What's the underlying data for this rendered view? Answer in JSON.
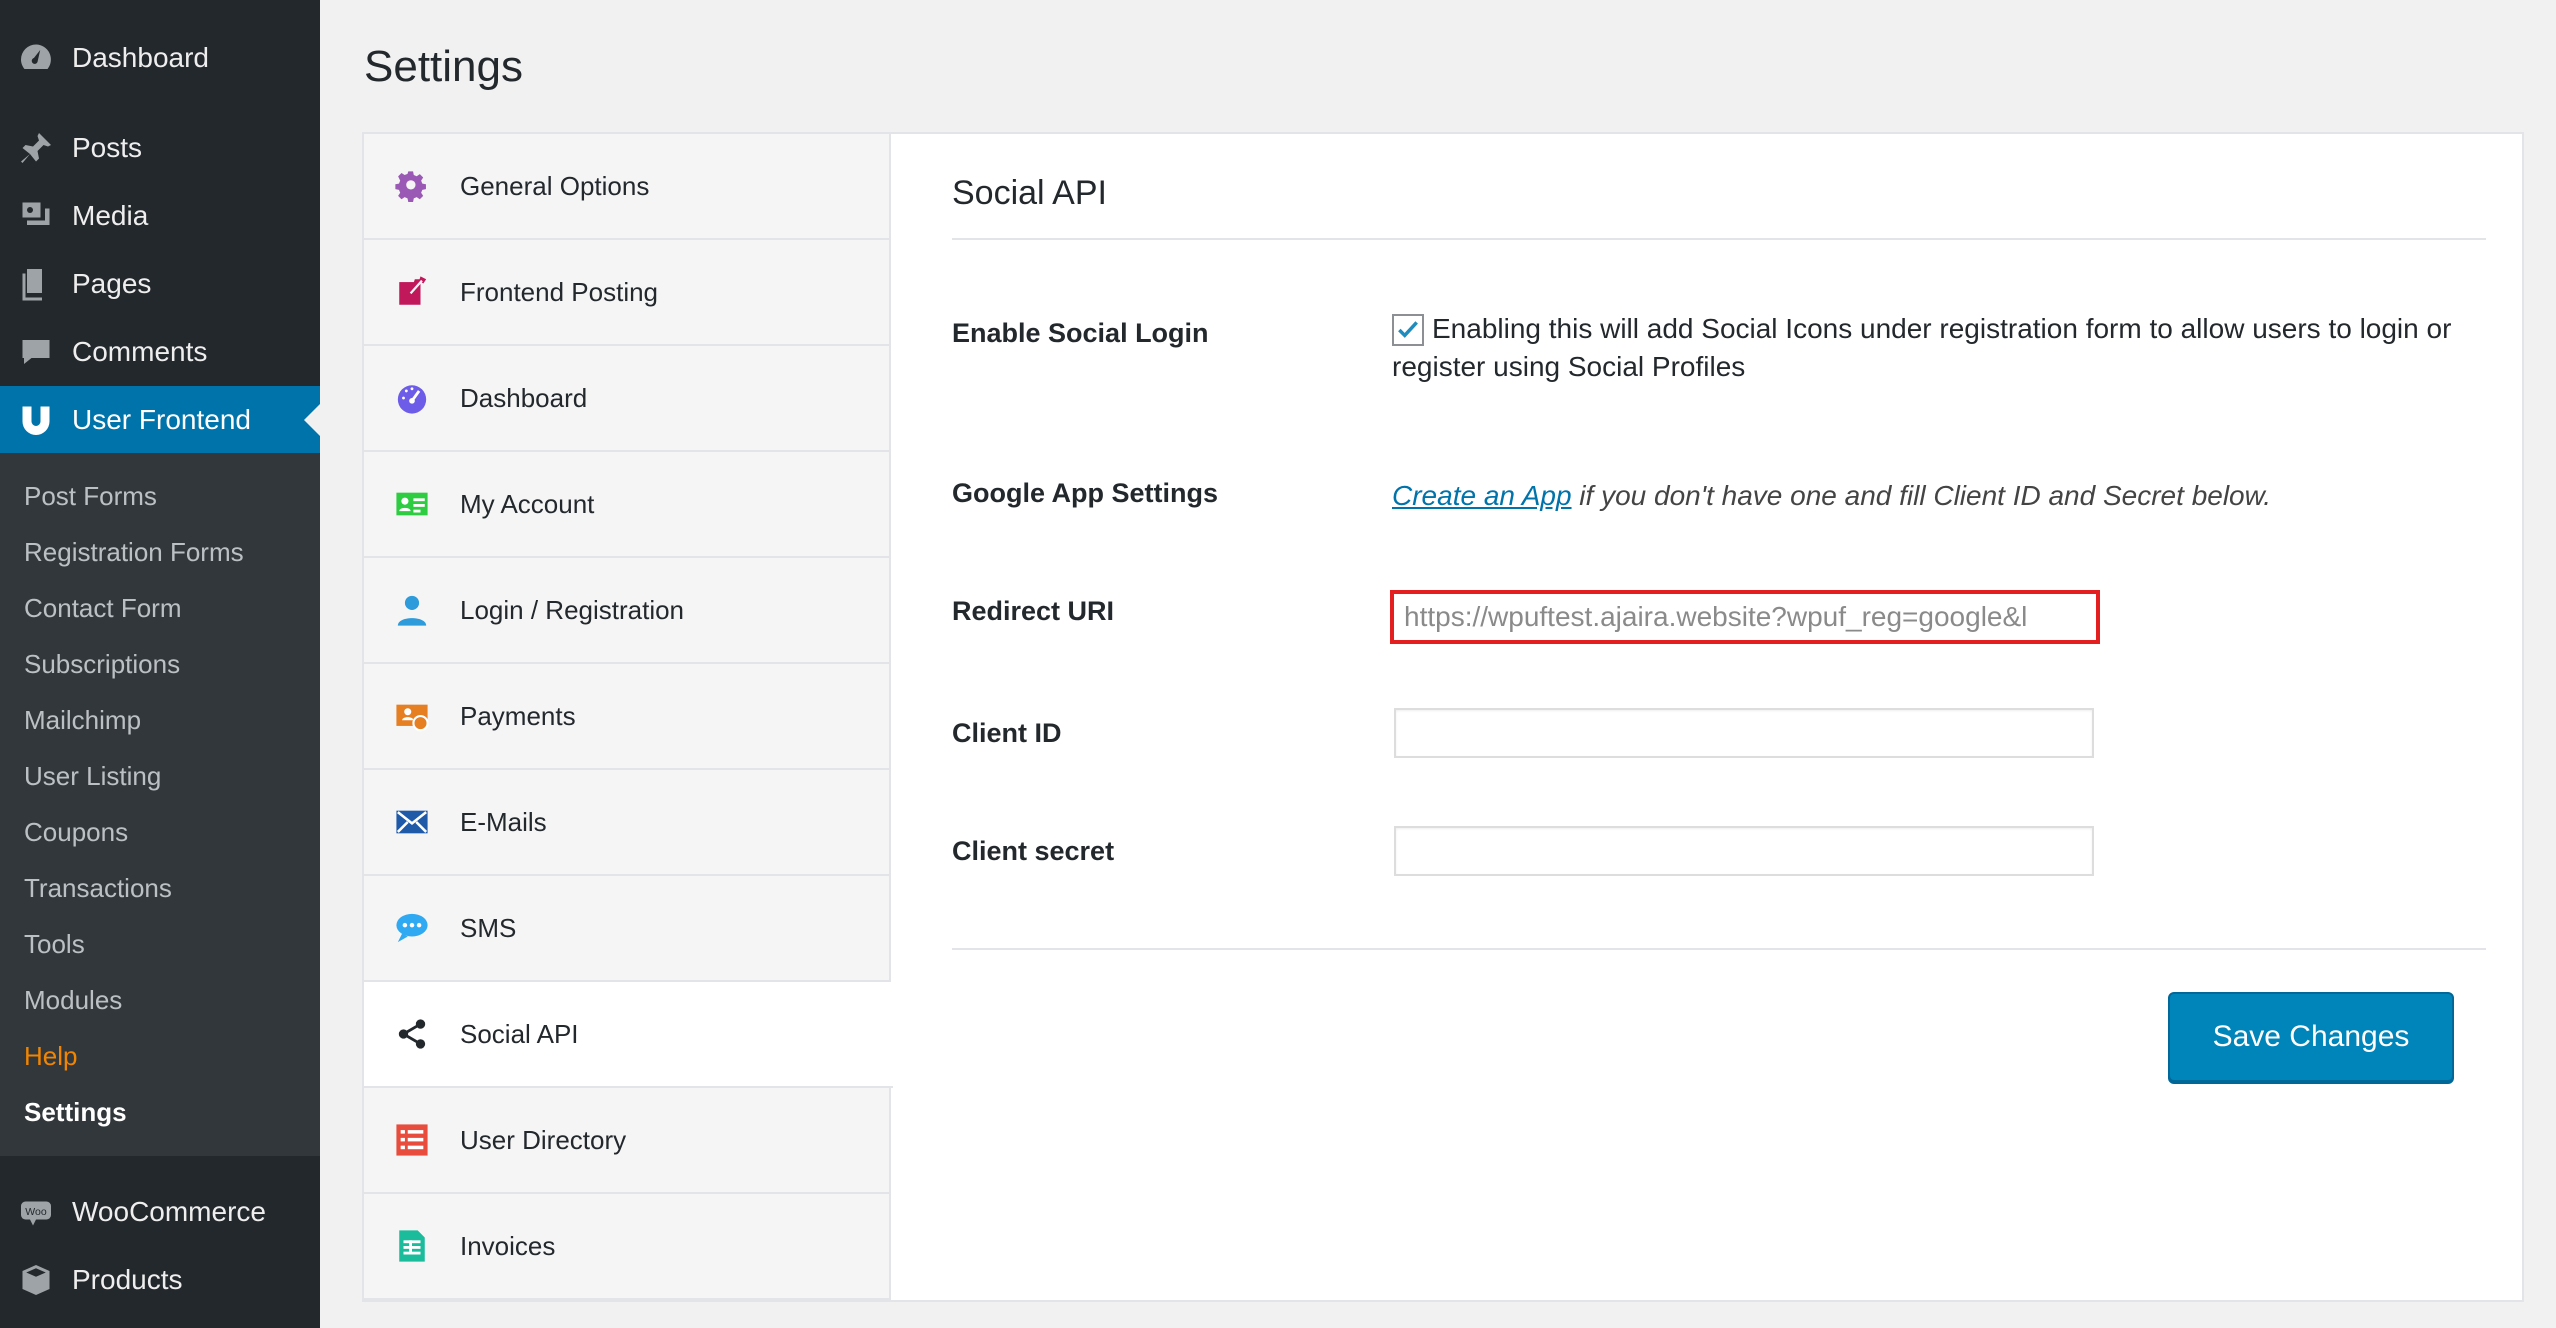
{
  "sidebar": {
    "top_items": [
      {
        "label": "Dashboard",
        "icon": "dashboard-icon"
      },
      {
        "label": "Posts",
        "icon": "pin-icon"
      },
      {
        "label": "Media",
        "icon": "media-icon"
      },
      {
        "label": "Pages",
        "icon": "pages-icon"
      },
      {
        "label": "Comments",
        "icon": "comment-icon"
      },
      {
        "label": "User Frontend",
        "icon": "user-frontend-icon"
      }
    ],
    "submenu": [
      "Post Forms",
      "Registration Forms",
      "Contact Form",
      "Subscriptions",
      "Mailchimp",
      "User Listing",
      "Coupons",
      "Transactions",
      "Tools",
      "Modules",
      "Help",
      "Settings"
    ],
    "bottom_items": [
      {
        "label": "WooCommerce",
        "icon": "woo-icon"
      },
      {
        "label": "Products",
        "icon": "box-icon"
      }
    ]
  },
  "page": {
    "title": "Settings"
  },
  "tabs": [
    {
      "label": "General Options",
      "icon": "gear-icon",
      "color": "#9b59b6"
    },
    {
      "label": "Frontend Posting",
      "icon": "edit-icon",
      "color": "#c0185b"
    },
    {
      "label": "Dashboard",
      "icon": "dashboard-icon",
      "color": "#6c5ce7"
    },
    {
      "label": "My Account",
      "icon": "id-card-icon",
      "color": "#2ecc40"
    },
    {
      "label": "Login / Registration",
      "icon": "user-icon",
      "color": "#2e9cdb"
    },
    {
      "label": "Payments",
      "icon": "payment-icon",
      "color": "#e67e22"
    },
    {
      "label": "E-Mails",
      "icon": "email-icon",
      "color": "#1e5aa8"
    },
    {
      "label": "SMS",
      "icon": "chat-icon",
      "color": "#2ea9f2"
    },
    {
      "label": "Social API",
      "icon": "share-icon",
      "color": "#23282d"
    },
    {
      "label": "User Directory",
      "icon": "list-icon",
      "color": "#e74c3c"
    },
    {
      "label": "Invoices",
      "icon": "invoice-icon",
      "color": "#1abc9c"
    }
  ],
  "content": {
    "section_title": "Social API",
    "enable_label": "Enable Social Login",
    "enable_desc": "Enabling this will add Social Icons under registration form to allow users to login or register using Social Profiles",
    "google_label": "Google App Settings",
    "google_link": "Create an App",
    "google_text": " if you don't have one and fill Client ID and Secret below.",
    "redirect_label": "Redirect URI",
    "redirect_value": "https://wpuftest.ajaira.website?wpuf_reg=google&l",
    "client_id_label": "Client ID",
    "client_id_value": "",
    "client_secret_label": "Client secret",
    "client_secret_value": "",
    "save_label": "Save Changes"
  },
  "colors": {
    "accent": "#0073aa",
    "highlight_border": "#e31f1f",
    "help": "#f18500"
  }
}
